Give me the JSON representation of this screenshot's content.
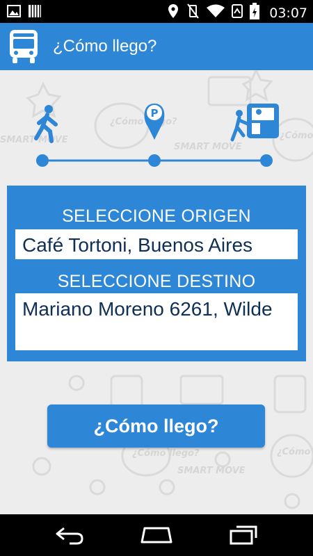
{
  "status_bar": {
    "time": "03:07"
  },
  "app_bar": {
    "title": "¿Cómo llego?"
  },
  "background": {
    "watermark_text_1": "¿Cómo llego?",
    "watermark_text_2": "SMART MOVE"
  },
  "form": {
    "origin_label": "SELECCIONE ORIGEN",
    "origin_value": "Café Tortoni, Buenos Aires",
    "destination_label": "SELECCIONE DESTINO",
    "destination_value": "Mariano Moreno 6261, Wilde"
  },
  "action": {
    "button_label": "¿Cómo llego?"
  },
  "colors": {
    "primary": "#2d86d6",
    "background": "#ededed",
    "field_text": "#0e2f56"
  },
  "icons": {
    "status_left": [
      "image-icon",
      "grid-icon"
    ],
    "status_right": [
      "location-icon",
      "vibrate-off-icon",
      "wifi-icon",
      "data-icon",
      "battery-icon"
    ],
    "steps": [
      "walking-person-icon",
      "parking-pin-icon",
      "bus-boarding-icon"
    ],
    "nav": [
      "back-icon",
      "home-icon",
      "recents-icon"
    ]
  }
}
